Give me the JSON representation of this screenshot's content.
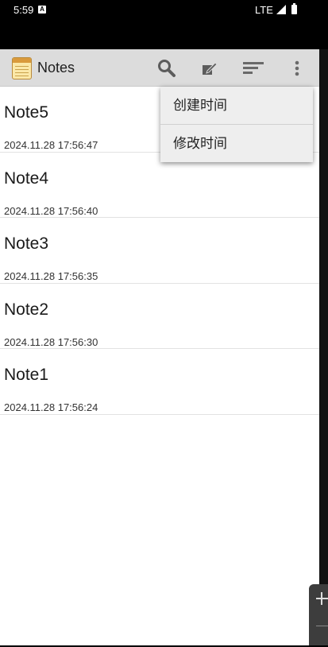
{
  "status_bar": {
    "time": "5:59",
    "notification_icon": "A",
    "network": "LTE"
  },
  "action_bar": {
    "title": "Notes",
    "icons": [
      "notepad-app-icon",
      "search-icon",
      "edit-icon",
      "sort-icon",
      "more-vert-icon"
    ]
  },
  "notes": [
    {
      "title": "Note5",
      "date": "2024.11.28 17:56:47"
    },
    {
      "title": "Note4",
      "date": "2024.11.28 17:56:40"
    },
    {
      "title": "Note3",
      "date": "2024.11.28 17:56:35"
    },
    {
      "title": "Note2",
      "date": "2024.11.28 17:56:30"
    },
    {
      "title": "Note1",
      "date": "2024.11.28 17:56:24"
    }
  ],
  "popup_menu": {
    "items": [
      {
        "label": "创建时间"
      },
      {
        "label": "修改时间"
      }
    ]
  },
  "colors": {
    "action_bar_bg": "#dcdcdc",
    "list_bg": "#ffffff",
    "popup_bg": "#eeeeee"
  }
}
